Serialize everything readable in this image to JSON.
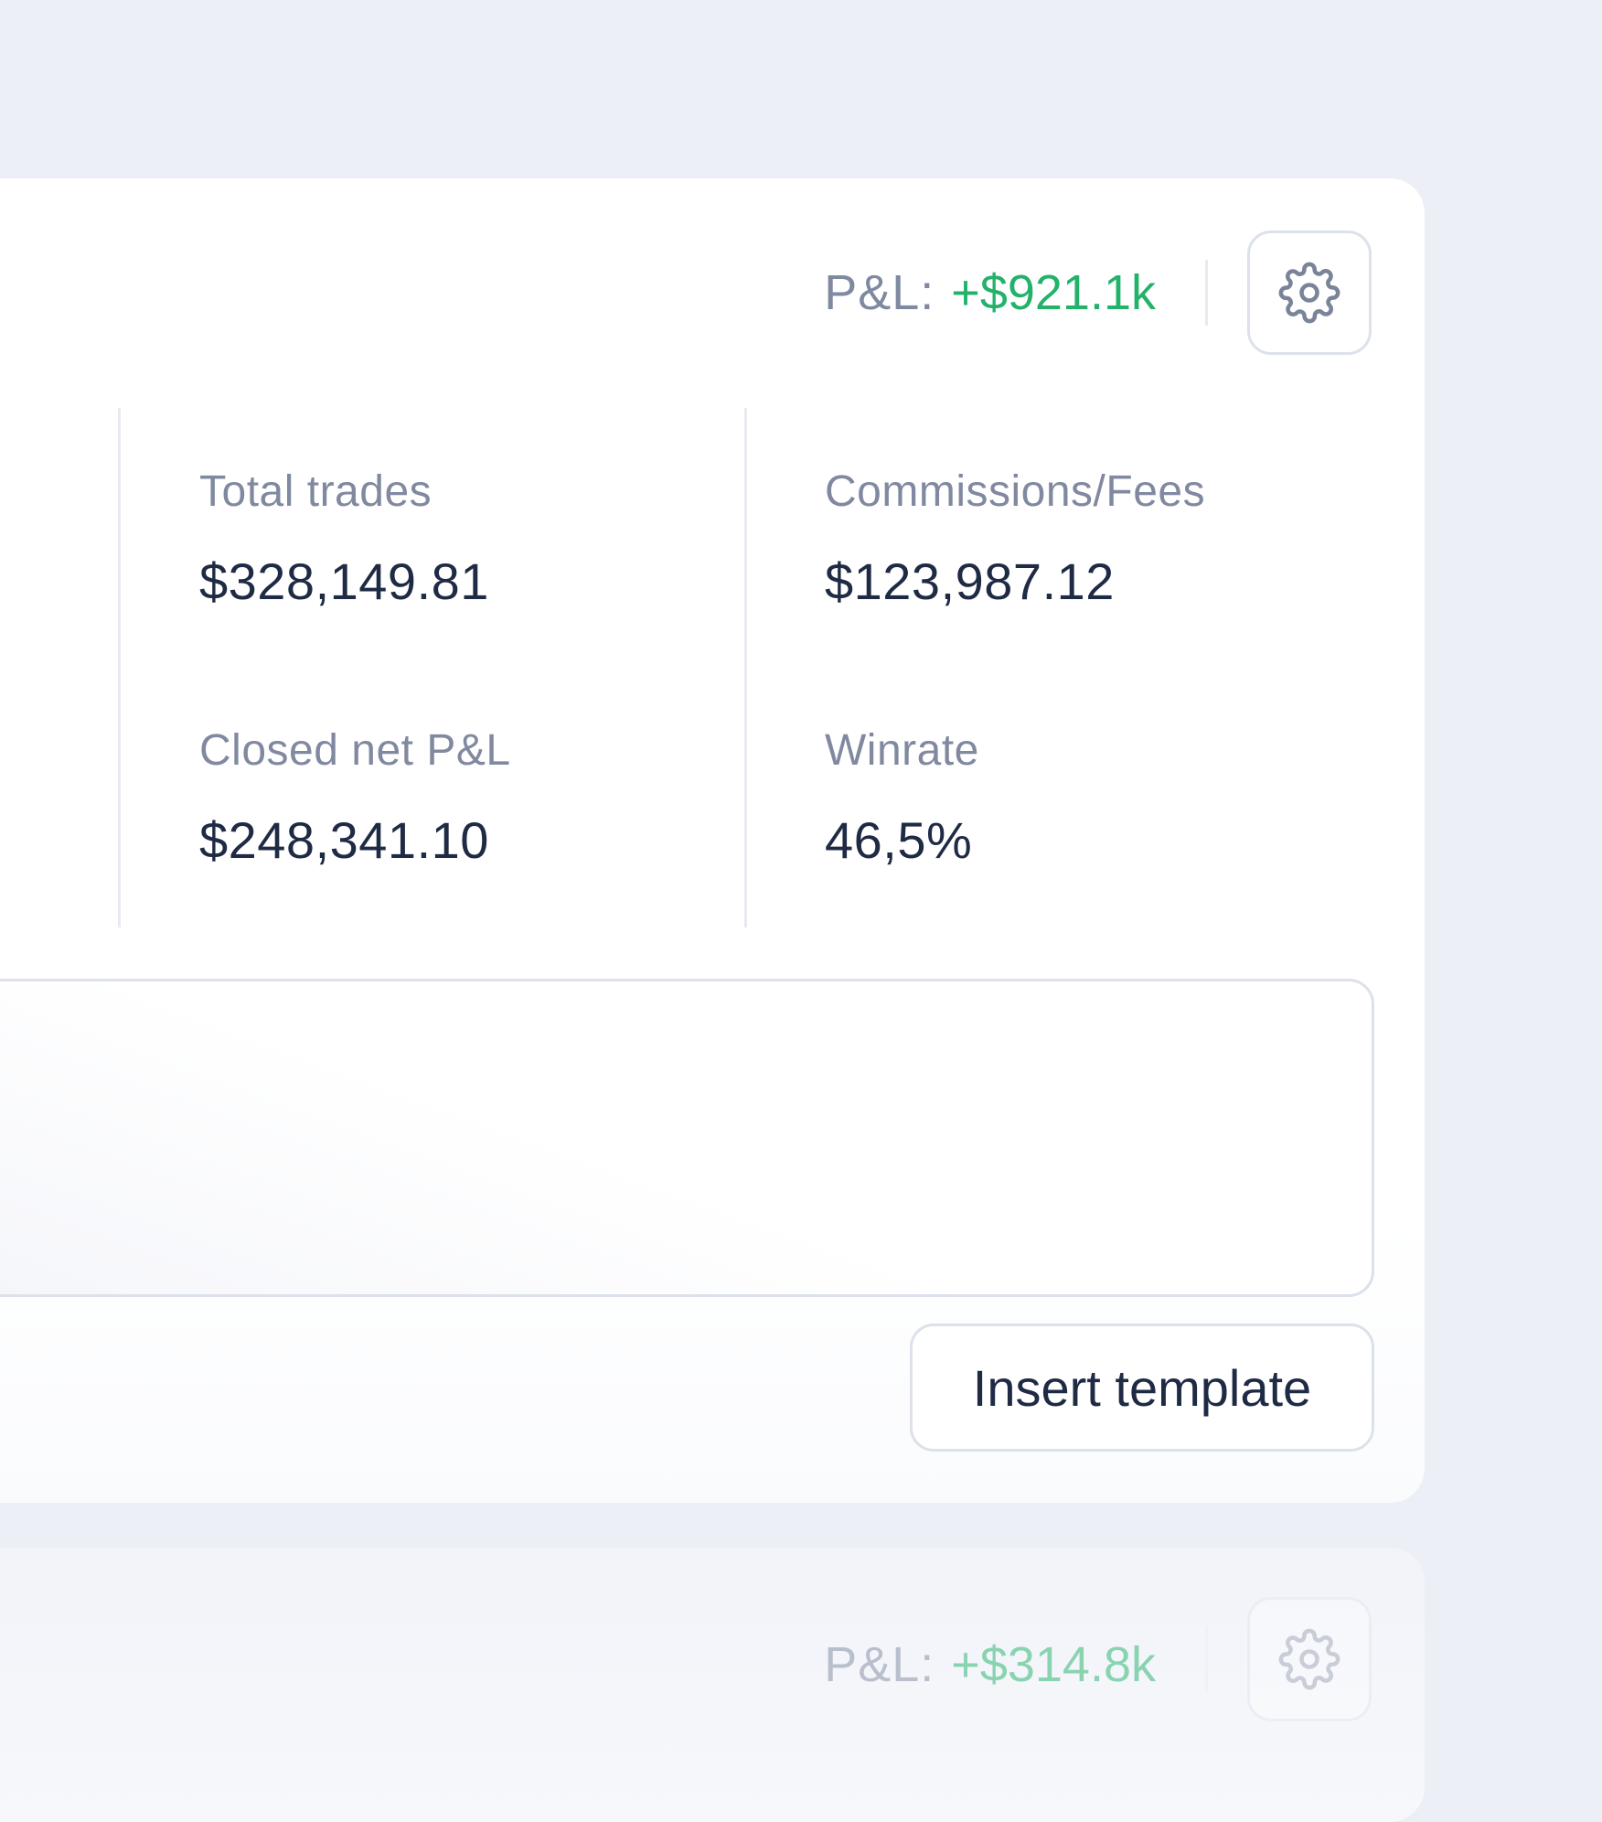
{
  "header": {
    "pnl_label": "P&L:",
    "pnl_value": "+$921.1k",
    "settings_icon": "gear-icon"
  },
  "stats": [
    {
      "label": "Total trades",
      "value": "$328,149.81"
    },
    {
      "label": "Commissions/Fees",
      "value": "$123,987.12"
    },
    {
      "label": "Closed net P&L",
      "value": "$248,341.10"
    },
    {
      "label": "Winrate",
      "value": "46,5%"
    }
  ],
  "notes": {
    "insert_button_label": "Insert template"
  },
  "next_card": {
    "pnl_label": "P&L:",
    "pnl_value": "+$314.8k"
  },
  "colors": {
    "background": "#eceff6",
    "card": "#ffffff",
    "profit_green": "#22b26a",
    "label_gray": "#8089a0",
    "value_dark": "#1f2a44",
    "border": "#dce1ea"
  }
}
